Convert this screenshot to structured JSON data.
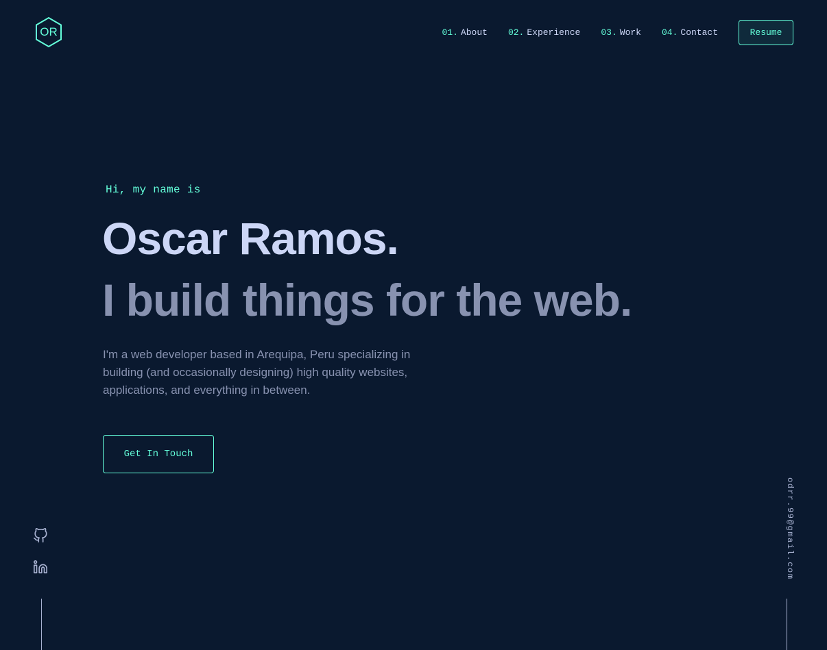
{
  "logo": {
    "text": "OR",
    "icon": "hexagon-logo-icon"
  },
  "nav": {
    "items": [
      {
        "num": "01.",
        "label": "About"
      },
      {
        "num": "02.",
        "label": "Experience"
      },
      {
        "num": "03.",
        "label": "Work"
      },
      {
        "num": "04.",
        "label": "Contact"
      }
    ],
    "resume_label": "Resume"
  },
  "hero": {
    "greeting": "Hi, my name is",
    "name": "Oscar Ramos.",
    "tagline": "I build things for the web.",
    "description": "I'm a web developer based in Arequipa, Peru specializing in building (and occasionally designing) high quality websites, applications, and everything in between.",
    "cta_label": "Get In Touch"
  },
  "social": {
    "icons": [
      "github-icon",
      "linkedin-icon"
    ]
  },
  "email": "odrr.99@gmail.com",
  "colors": {
    "background": "#0a192f",
    "accent": "#64ffda",
    "heading": "#ccd6f6",
    "text": "#8892b0",
    "line": "#a8b2d1"
  }
}
